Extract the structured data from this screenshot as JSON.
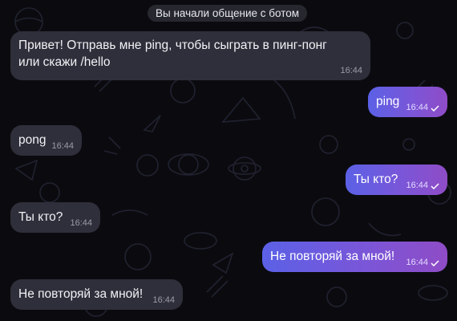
{
  "service_message": "Вы начали общение с ботом",
  "messages": [
    {
      "direction": "incoming",
      "lines": [
        "Привет! Отправь мне ping, чтобы сыграть в пинг-понг",
        "или скажи /hello"
      ],
      "time": "16:44"
    },
    {
      "direction": "outgoing",
      "text": "ping",
      "time": "16:44",
      "status": "delivered"
    },
    {
      "direction": "incoming",
      "text": "pong",
      "time": "16:44"
    },
    {
      "direction": "outgoing",
      "text": "Ты кто?",
      "time": "16:44",
      "status": "delivered"
    },
    {
      "direction": "incoming",
      "text": "Ты кто?",
      "time": "16:44"
    },
    {
      "direction": "outgoing",
      "text": "Не повторяй за мной!",
      "time": "16:44",
      "status": "delivered"
    },
    {
      "direction": "incoming",
      "text": "Не повторяй за мной!",
      "time": "16:44"
    }
  ],
  "colors": {
    "chat_background": "#0b0b0f",
    "incoming_bubble": "#2f2f3b",
    "outgoing_gradient_start": "#5b61e6",
    "outgoing_gradient_end": "#8f4cc6"
  },
  "icons": {
    "delivered": "check-icon",
    "background_pattern": "space-doodle-pattern"
  }
}
